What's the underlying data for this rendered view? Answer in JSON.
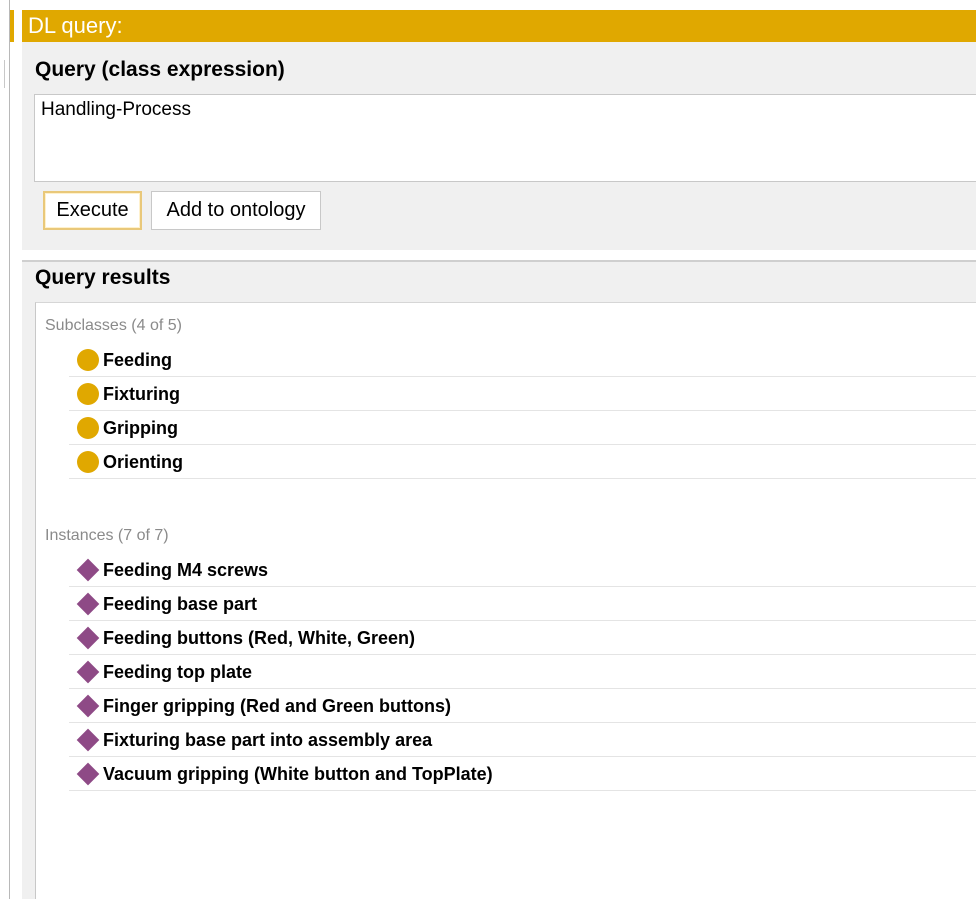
{
  "panel": {
    "title": "DL query:"
  },
  "query": {
    "heading": "Query (class expression)",
    "expression": "Handling-Process",
    "buttons": {
      "execute": "Execute",
      "add_to_ontology": "Add to ontology"
    }
  },
  "results": {
    "heading": "Query results",
    "subclasses": {
      "label": "Subclasses (4 of 5)",
      "icon": "class-circle-icon",
      "icon_color": "#e0a800",
      "items": [
        "Feeding",
        "Fixturing",
        "Gripping",
        "Orienting"
      ]
    },
    "instances": {
      "label": "Instances (7 of 7)",
      "icon": "individual-diamond-icon",
      "icon_color": "#8e4a86",
      "items": [
        "Feeding M4 screws",
        "Feeding base part",
        "Feeding buttons (Red, White, Green)",
        "Feeding top plate",
        "Finger gripping (Red and Green buttons)",
        "Fixturing base part into assembly area",
        "Vacuum gripping (White button and TopPlate)"
      ]
    }
  },
  "colors": {
    "accent": "#e0a800",
    "panel_bg": "#f0f0f0",
    "instance_icon": "#8e4a86"
  }
}
